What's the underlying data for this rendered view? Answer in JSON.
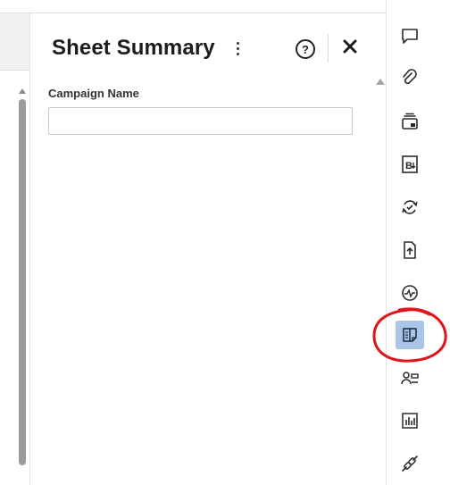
{
  "panel": {
    "title": "Sheet Summary",
    "help_symbol": "?",
    "fields": [
      {
        "label": "Campaign Name",
        "value": "",
        "placeholder": ""
      }
    ]
  },
  "rail": {
    "icons": [
      "comment-icon",
      "attachment-icon",
      "proofing-icon",
      "brandfolder-icon",
      "update-requests-icon",
      "publish-icon",
      "activity-log-icon",
      "sheet-summary-icon",
      "contacts-icon",
      "insights-icon",
      "connectors-icon"
    ],
    "active_icon": "sheet-summary-icon"
  },
  "colors": {
    "active_background": "#a9c5e8",
    "annotation_circle": "#e0141b"
  }
}
